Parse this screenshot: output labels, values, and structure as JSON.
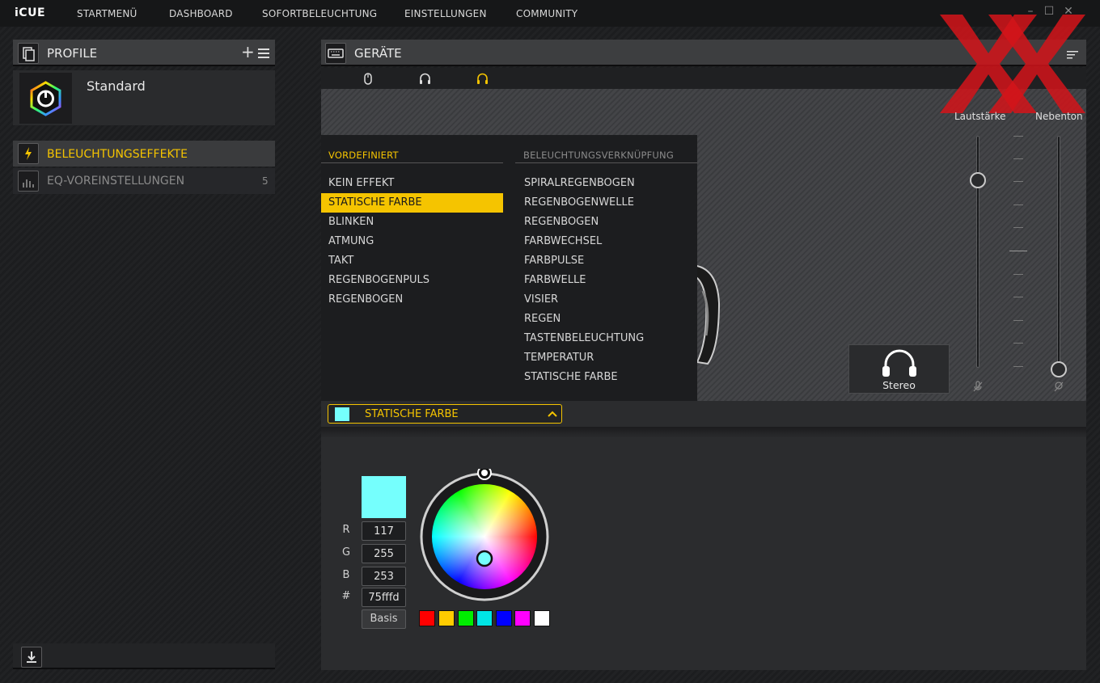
{
  "app": {
    "logo": "iCUE",
    "nav": [
      "STARTMENÜ",
      "DASHBOARD",
      "SOFORTBELEUCHTUNG",
      "EINSTELLUNGEN",
      "COMMUNITY"
    ]
  },
  "profiles": {
    "title": "PROFILE",
    "items": [
      {
        "name": "Standard"
      }
    ]
  },
  "sidebar_menu": [
    {
      "label": "BELEUCHTUNGSEFFEKTE",
      "active": true
    },
    {
      "label": "EQ-VOREINSTELLUNGEN",
      "count": "5",
      "active": false
    }
  ],
  "devices": {
    "title": "GERÄTE",
    "tabs": [
      "mouse-icon",
      "headset-icon",
      "headset-icon"
    ],
    "active_tab": 2
  },
  "dropdown": {
    "col1_header": "VORDEFINIERT",
    "col1_items": [
      "KEIN EFFEKT",
      "STATISCHE FARBE",
      "BLINKEN",
      "ATMUNG",
      "TAKT",
      "REGENBOGENPULS",
      "REGENBOGEN"
    ],
    "col1_selected": 1,
    "col2_header": "BELEUCHTUNGSVERKNÜPFUNG",
    "col2_items": [
      "SPIRALREGENBOGEN",
      "REGENBOGENWELLE",
      "REGENBOGEN",
      "FARBWECHSEL",
      "FARBPULSE",
      "FARBWELLE",
      "VISIER",
      "REGEN",
      "TASTENBELEUCHTUNG",
      "TEMPERATUR",
      "STATISCHE FARBE"
    ]
  },
  "effect_select": {
    "label": "STATISCHE FARBE"
  },
  "color": {
    "hex_color": "#75fffd",
    "r_label": "R",
    "g_label": "G",
    "b_label": "B",
    "hex_label": "#",
    "r": "117",
    "g": "255",
    "b": "253",
    "hex": "75fffd",
    "basis_label": "Basis",
    "presets": [
      "#ff0000",
      "#ffcc00",
      "#00ee00",
      "#00e5e5",
      "#0000ff",
      "#ff00ff",
      "#ffffff"
    ]
  },
  "audio": {
    "volume_label": "Lautstärke",
    "sidetone_label": "Nebenton",
    "volume_level": 0.84,
    "sidetone_level": 0.0,
    "mode_label": "Stereo"
  },
  "colors": {
    "accent": "#f5c400"
  }
}
